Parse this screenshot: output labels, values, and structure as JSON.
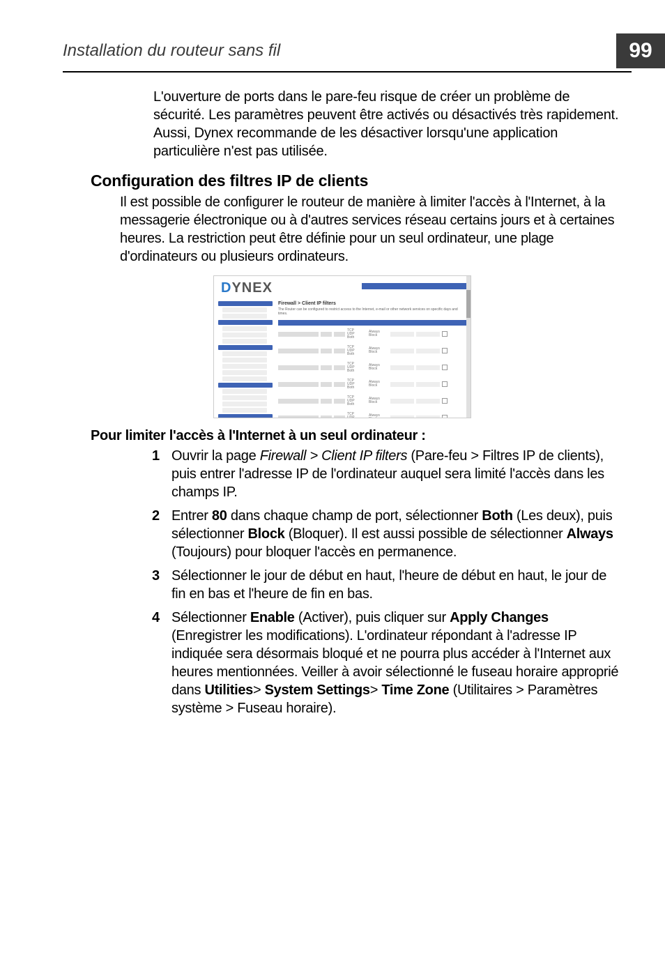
{
  "page": {
    "number": "99",
    "header_title": "Installation du routeur sans fil"
  },
  "intro_para": "L'ouverture de ports dans le pare-feu risque de créer un problème de sécurité. Les paramètres peuvent être activés ou désactivés très rapidement. Aussi, Dynex recommande de les désactiver lorsqu'une application particulière n'est pas utilisée.",
  "section_heading": "Configuration des filtres IP de clients",
  "section_para": "Il est possible de configurer le routeur de manière à limiter l'accès à l'Internet, à la messagerie électronique ou à d'autres services réseau certains jours et à certaines heures. La restriction peut être définie pour un seul ordinateur, une plage d'ordinateurs ou plusieurs ordinateurs.",
  "setup_heading": "Pour limiter l'accès à l'Internet à un seul ordinateur :",
  "steps": [
    {
      "pre": "Ouvrir la page ",
      "ital": "Firewall > Client IP filters",
      "post": " (Pare-feu > Filtres IP de clients), puis entrer l'adresse IP de l'ordinateur auquel sera limité l'accès dans les champs IP."
    },
    {
      "pre": "Entrer ",
      "b1": "80",
      "m1": " dans chaque champ de port, sélectionner ",
      "b2": "Both",
      "m2": " (Les deux), puis sélectionner ",
      "b3": "Block",
      "m3": " (Bloquer). Il est aussi possible de sélectionner ",
      "b4": "Always",
      "post": " (Toujours) pour bloquer l'accès en permanence."
    },
    {
      "text": "Sélectionner le jour de début en haut, l'heure de début en haut, le jour de fin en bas et l'heure de fin en bas."
    },
    {
      "pre": "Sélectionner ",
      "b1": "Enable",
      "m1": " (Activer), puis cliquer sur ",
      "b2": "Apply Changes",
      "m2": " (Enregistrer les modifications). L'ordinateur répondant à l'adresse IP indiquée sera désormais bloqué et ne pourra plus accéder à l'Internet aux heures mentionnées. Veiller à avoir sélectionné le fuseau horaire approprié dans ",
      "b3": "Utilities",
      "m3": "> ",
      "b4": "System Settings",
      "m4": "> ",
      "b5": "Time Zone",
      "post": " (Utilitaires > Paramètres système > Fuseau horaire)."
    }
  ],
  "screenshot": {
    "logo_text": "DYNEX",
    "panel_title": "Firewall > Client IP filters",
    "panel_desc": "The Router can be configured to restrict access to the Internet, e-mail or other network services on specific days and times."
  }
}
